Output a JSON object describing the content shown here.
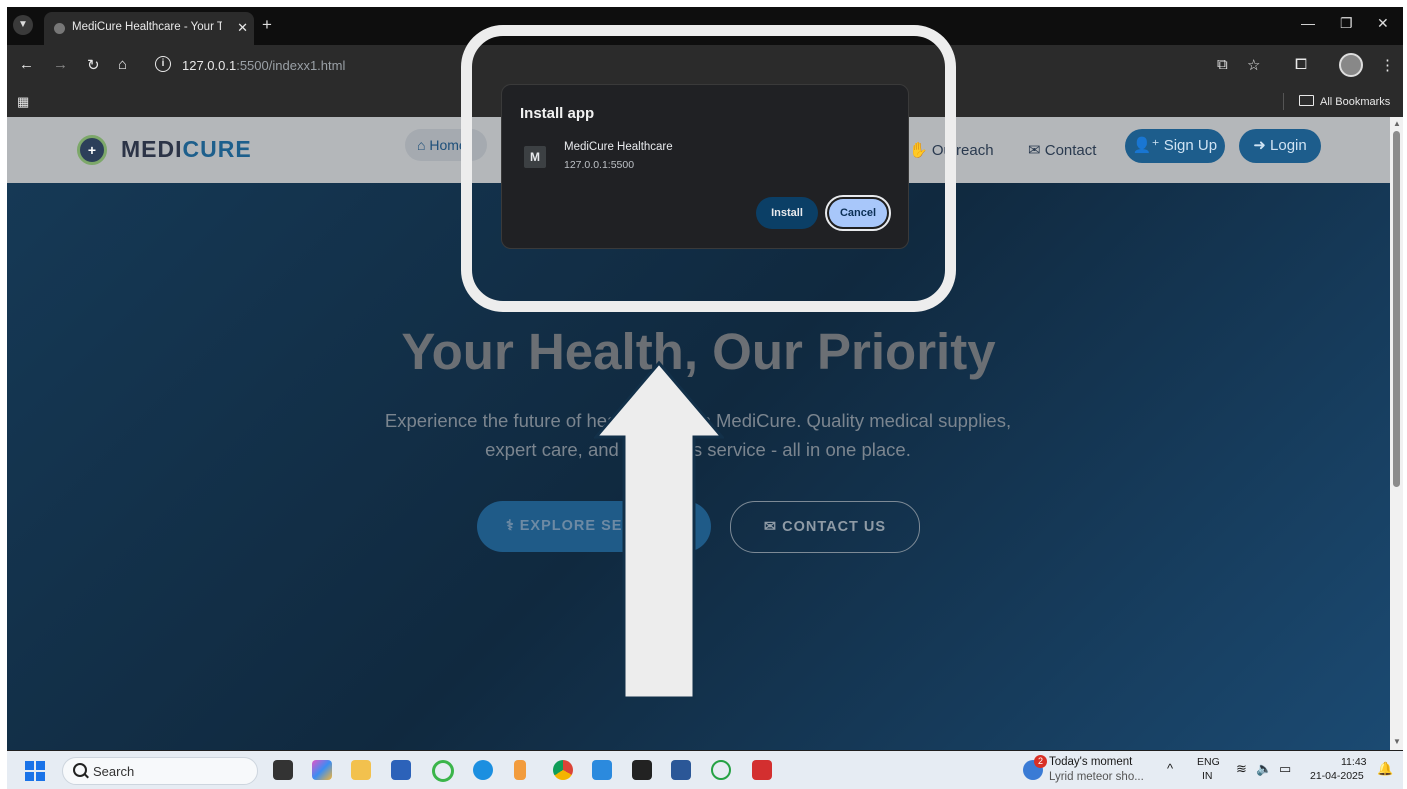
{
  "browser": {
    "tab_title": "MediCure Healthcare - Your Tru",
    "tab_close": "✕",
    "new_tab": "+",
    "url_host": "127.0.0.1",
    "url_path": ":5500/indexx1.html",
    "all_bookmarks": "All Bookmarks"
  },
  "site": {
    "logo_part1": "MEDI",
    "logo_part2": "CURE",
    "nav": {
      "home": "Home",
      "outreach": "Outreach",
      "contact": "Contact",
      "signup": "Sign Up",
      "login": "Login"
    },
    "hero_title": "Your Health, Our Priority",
    "hero_line1": "Experience the future of healthcare with MediCure. Quality medical supplies,",
    "hero_line2": "expert care, and seamless service - all in one place.",
    "btn_explore": "EXPLORE SERVICES",
    "btn_contact": "CONTACT US"
  },
  "dialog": {
    "title": "Install app",
    "app_icon_letter": "M",
    "app_name": "MediCure Healthcare",
    "app_origin": "127.0.0.1:5500",
    "install": "Install",
    "cancel": "Cancel"
  },
  "taskbar": {
    "search": "Search",
    "news_badge": "2",
    "news_title": "Today's moment",
    "news_sub": "Lyrid meteor sho...",
    "lang1": "ENG",
    "lang2": "IN",
    "time": "11:43",
    "date": "21-04-2025"
  },
  "colors": {
    "highlight": "#ededed",
    "arrow": "#ededed",
    "accent": "#1d5d8c",
    "dialog_cancel": "#a8c7fa"
  }
}
